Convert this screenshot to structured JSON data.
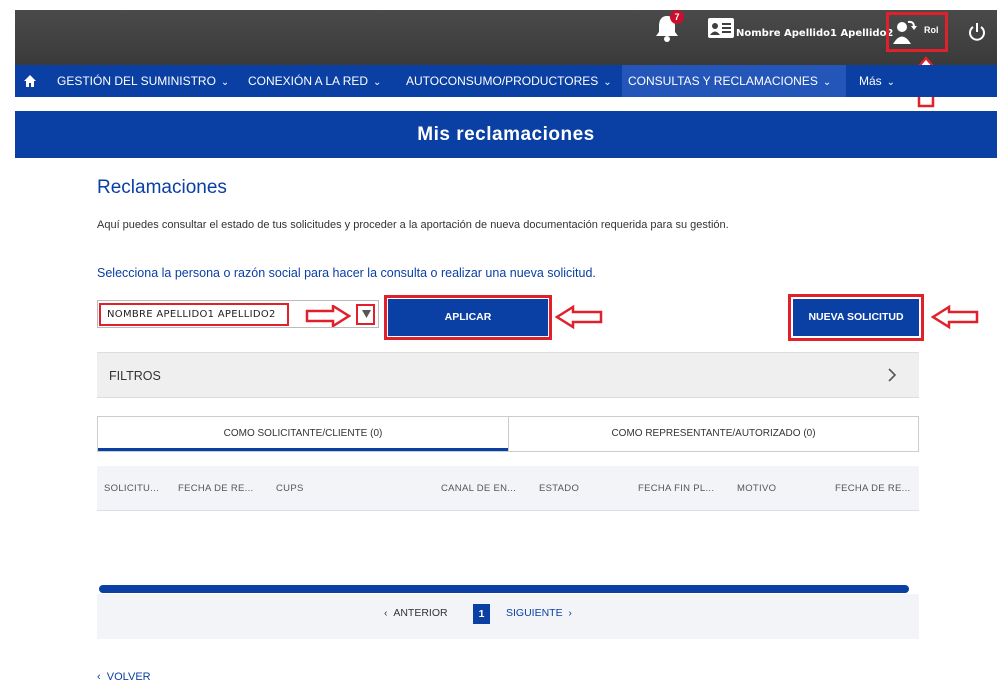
{
  "header": {
    "notifications_count": "7",
    "user_name": "Nombre Apellido1 Apellido2",
    "role_label": "Rol"
  },
  "nav": {
    "items": [
      {
        "label": "GESTIÓN DEL SUMINISTRO"
      },
      {
        "label": "CONEXIÓN A LA RED"
      },
      {
        "label": "AUTOCONSUMO/PRODUCTORES"
      },
      {
        "label": "CONSULTAS Y RECLAMACIONES"
      },
      {
        "label": "Más"
      }
    ]
  },
  "page": {
    "title": "Mis reclamaciones",
    "section_title": "Reclamaciones",
    "description": "Aquí puedes consultar el estado de tus solicitudes y proceder a la aportación de nueva documentación requerida para su gestión.",
    "select_prompt": "Selecciona la persona o razón social para hacer la consulta o realizar una nueva solicitud.",
    "select_value": "NOMBRE  APELLIDO1  APELLIDO2",
    "apply_label": "APLICAR",
    "new_request_label": "NUEVA SOLICITUD",
    "filters_label": "FILTROS"
  },
  "tabs": [
    {
      "label": "COMO SOLICITANTE/CLIENTE (0)",
      "active": true
    },
    {
      "label": "COMO REPRESENTANTE/AUTORIZADO (0)",
      "active": false
    }
  ],
  "table": {
    "columns": [
      "SOLICITU...",
      "FECHA DE RE...",
      "CUPS",
      "CANAL DE EN...",
      "ESTADO",
      "FECHA FIN PL...",
      "MOTIVO",
      "FECHA DE RE..."
    ]
  },
  "pagination": {
    "prev_label": "ANTERIOR",
    "current_page": "1",
    "next_label": "SIGUIENTE"
  },
  "footer": {
    "back_label": "VOLVER"
  },
  "colors": {
    "brand_blue": "#0a3fa3",
    "highlight_red": "#e0202a",
    "topbar_gray": "#404040"
  }
}
